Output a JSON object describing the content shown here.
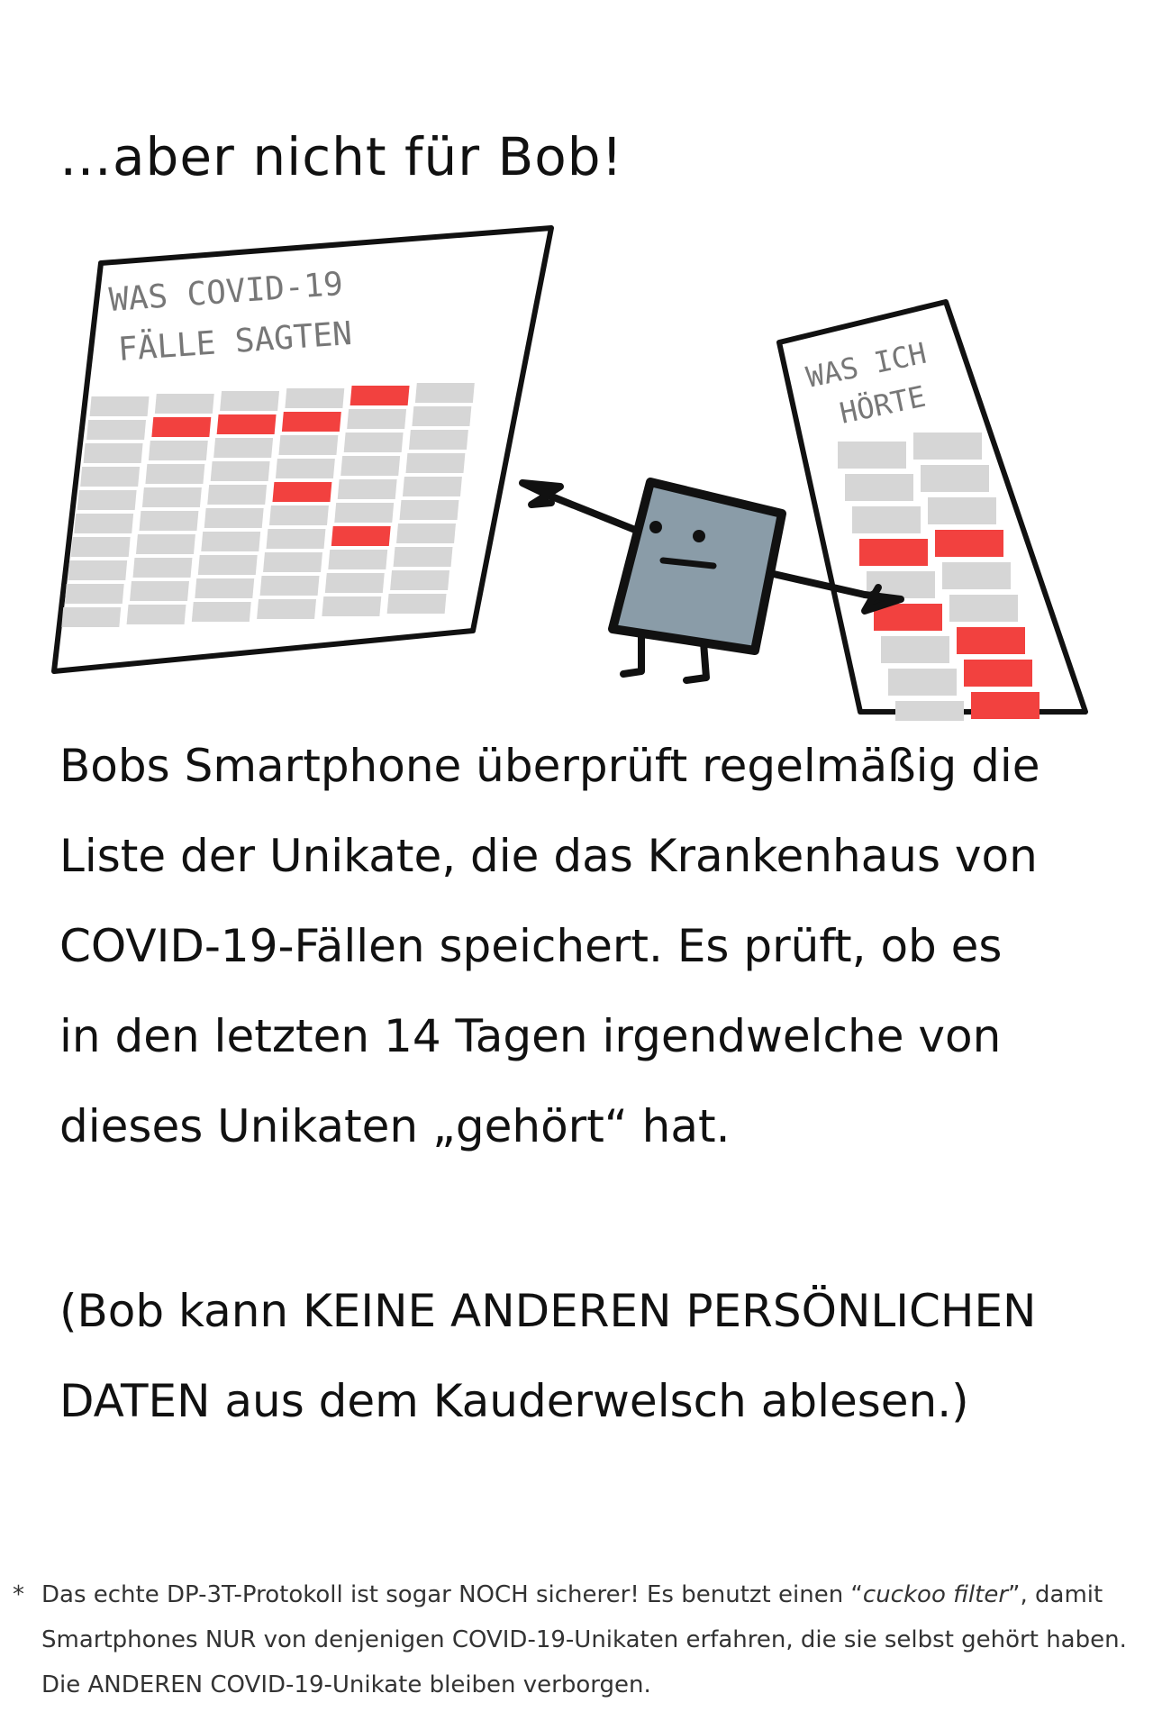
{
  "heading": "…aber nicht für Bob!",
  "poster_left": {
    "label_line1": "WAS COVID-19",
    "label_line2": "FÄLLE SAGTEN"
  },
  "poster_right": {
    "label_line1": "WAS ICH",
    "label_line2": "HÖRTE"
  },
  "body": "Bobs Smartphone überprüft regelmäßig die\nListe der Unikate, die das Krankenhaus von\nCOVID-19-Fällen speichert. Es prüft, ob es\nin den letzten 14 Tagen irgendwelche von\ndieses Unikaten „gehört“ hat.",
  "note": "(Bob kann KEINE ANDEREN PERSÖNLICHEN\nDATEN aus dem Kauderwelsch ablesen.)",
  "footnote": {
    "marker": "*",
    "before": "Das echte DP-3T-Protokoll ist sogar NOCH sicherer! Es benutzt einen “",
    "term": "cuckoo filter",
    "after": "”, damit Smartphones NUR von denjenigen COVID-19-Unikaten erfahren, die sie selbst gehört haben. Die ANDEREN COVID-19-Unikate bleiben verborgen."
  },
  "colors": {
    "highlight": "#f2413f",
    "cell": "#d6d6d6",
    "phone": "#8a9ca8",
    "ink": "#111111"
  }
}
